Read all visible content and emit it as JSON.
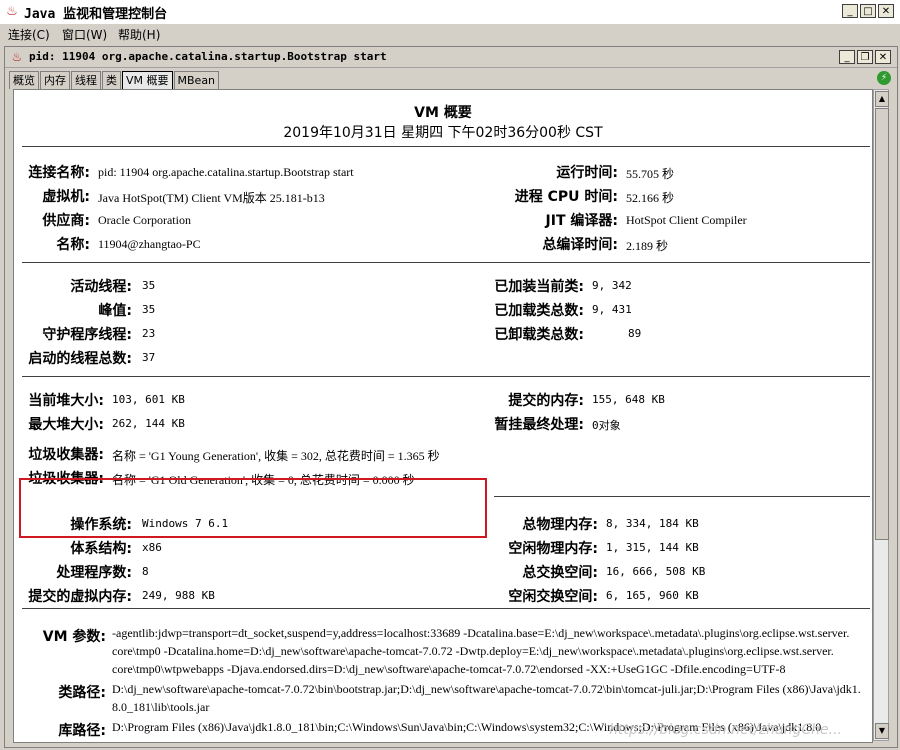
{
  "window": {
    "title": "Java 监视和管理控制台",
    "icon": "java-cup-icon"
  },
  "menu": [
    "连接(C)",
    "窗口(W)",
    "帮助(H)"
  ],
  "inner_title": "pid: 11904 org.apache.catalina.startup.Bootstrap start",
  "tabs": [
    "概览",
    "内存",
    "线程",
    "类",
    "VM 概要",
    "MBean"
  ],
  "header": {
    "title": "VM 概要",
    "timestamp": "2019年10月31日 星期四 下午02时36分00秒 CST"
  },
  "section1": {
    "left": [
      {
        "label": "连接名称:",
        "value": "pid: 11904 org.apache.catalina.startup.Bootstrap start"
      },
      {
        "label": "虚拟机:",
        "value": "Java HotSpot(TM) Client VM版本 25.181-b13"
      },
      {
        "label": "供应商:",
        "value": "Oracle Corporation"
      },
      {
        "label": "名称:",
        "value": "11904@zhangtao-PC"
      }
    ],
    "right": [
      {
        "label": "运行时间:",
        "value": "55.705 秒"
      },
      {
        "label": "进程 CPU 时间:",
        "value": "52.166 秒"
      },
      {
        "label": "JIT 编译器:",
        "value": "HotSpot Client Compiler"
      },
      {
        "label": "总编译时间:",
        "value": "2.189 秒"
      }
    ]
  },
  "section2": {
    "left": [
      {
        "label": "活动线程:",
        "value": "35"
      },
      {
        "label": "峰值:",
        "value": "35"
      },
      {
        "label": "守护程序线程:",
        "value": "23"
      },
      {
        "label": "启动的线程总数:",
        "value": "37"
      }
    ],
    "right": [
      {
        "label": "已加装当前类:",
        "value": "9, 342"
      },
      {
        "label": "已加载类总数:",
        "value": "9, 431"
      },
      {
        "label": "已卸载类总数:",
        "value": "89"
      }
    ]
  },
  "section3": {
    "left": [
      {
        "label": "当前堆大小:",
        "value": "103, 601 KB"
      },
      {
        "label": "最大堆大小:",
        "value": "262, 144 KB"
      }
    ],
    "right": [
      {
        "label": "提交的内存:",
        "value": "155, 648 KB"
      },
      {
        "label": "暂挂最终处理:",
        "value": "0对象"
      }
    ],
    "gc": [
      {
        "label": "垃圾收集器:",
        "value": "名称 = 'G1 Young Generation', 收集 = 302, 总花费时间 = 1.365 秒"
      },
      {
        "label": "垃圾收集器:",
        "value": "名称 = 'G1 Old Generation', 收集 = 0, 总花费时间 = 0.000 秒"
      }
    ]
  },
  "section4": {
    "left": [
      {
        "label": "操作系统:",
        "value": "Windows 7 6.1"
      },
      {
        "label": "体系结构:",
        "value": "x86"
      },
      {
        "label": "处理程序数:",
        "value": "8"
      },
      {
        "label": "提交的虚拟内存:",
        "value": "249, 988 KB"
      }
    ],
    "right": [
      {
        "label": "总物理内存:",
        "value": "8, 334, 184 KB"
      },
      {
        "label": "空闲物理内存:",
        "value": "1, 315, 144 KB"
      },
      {
        "label": "总交换空间:",
        "value": "16, 666, 508 KB"
      },
      {
        "label": "空闲交换空间:",
        "value": "6, 165, 960 KB"
      }
    ]
  },
  "section5": {
    "vm_args_label": "VM 参数:",
    "vm_args": [
      "-agentlib:jdwp=transport=dt_socket,suspend=y,address=localhost:33689 -Dcatalina.base=E:\\dj_new\\workspace\\.metadata\\.plugins\\org.eclipse.wst.server.",
      "core\\tmp0 -Dcatalina.home=D:\\dj_new\\software\\apache-tomcat-7.0.72 -Dwtp.deploy=E:\\dj_new\\workspace\\.metadata\\.plugins\\org.eclipse.wst.server.",
      "core\\tmp0\\wtpwebapps -Djava.endorsed.dirs=D:\\dj_new\\software\\apache-tomcat-7.0.72\\endorsed -XX:+UseG1GC -Dfile.encoding=UTF-8"
    ],
    "classpath_label": "类路径:",
    "classpath": [
      "D:\\dj_new\\software\\apache-tomcat-7.0.72\\bin\\bootstrap.jar;D:\\dj_new\\software\\apache-tomcat-7.0.72\\bin\\tomcat-juli.jar;D:\\Program Files (x86)\\Java\\jdk1.",
      "8.0_181\\lib\\tools.jar"
    ],
    "libpath_label": "库路径:",
    "libpath": [
      "D:\\Program Files (x86)\\Java\\jdk1.8.0_181\\bin;C:\\Windows\\Sun\\Java\\bin;C:\\Windows\\system32;C:\\Windows;D:\\Program Files (x86)\\Java\\jdk1.8.0"
    ]
  },
  "watermark": "https://blog.csdn.net/zhangChe..."
}
